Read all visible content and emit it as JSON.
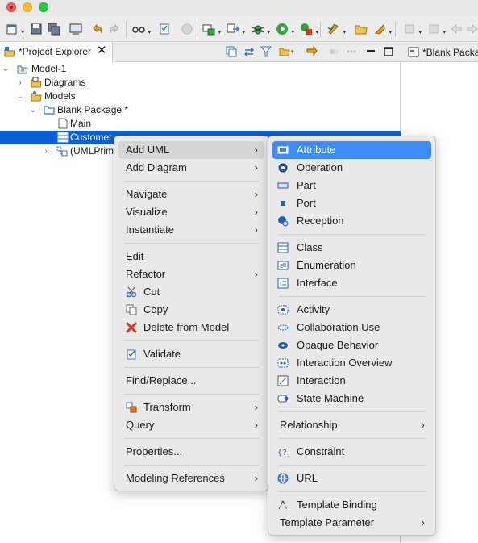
{
  "explorer": {
    "tab_title": "*Project Explorer",
    "close_glyph": "✕",
    "tree": [
      {
        "label": "Model-1",
        "icon": "model-folder-icon"
      },
      {
        "label": "Diagrams",
        "icon": "diagrams-folder-icon"
      },
      {
        "label": "Models",
        "icon": "models-folder-icon"
      },
      {
        "label": "Blank Package *",
        "icon": "package-icon"
      },
      {
        "label": "Main",
        "icon": "diagram-file-icon"
      },
      {
        "label": "Customer",
        "icon": "class-icon",
        "selected": true
      },
      {
        "label": "(UMLPrimi",
        "icon": "library-icon"
      }
    ]
  },
  "editor_tab": {
    "title": "*Blank Packa"
  },
  "context_menu": {
    "items": [
      {
        "label": "Add UML",
        "submenu": true,
        "state": "open"
      },
      {
        "label": "Add Diagram",
        "submenu": true
      },
      {
        "label": "Navigate",
        "submenu": true
      },
      {
        "label": "Visualize",
        "submenu": true
      },
      {
        "label": "Instantiate",
        "submenu": true
      },
      {
        "label": "Edit"
      },
      {
        "label": "Refactor",
        "submenu": true
      },
      {
        "label": "Cut",
        "icon": "scissors-icon"
      },
      {
        "label": "Copy",
        "icon": "copy-icon"
      },
      {
        "label": "Delete from Model",
        "icon": "delete-icon"
      },
      {
        "label": "Validate",
        "icon": "validate-icon"
      },
      {
        "label": "Find/Replace..."
      },
      {
        "label": "Transform",
        "submenu": true,
        "icon": "transform-icon"
      },
      {
        "label": "Query",
        "submenu": true
      },
      {
        "label": "Properties..."
      },
      {
        "label": "Modeling References",
        "submenu": true
      }
    ],
    "submenu_arrow": "›"
  },
  "uml_submenu": {
    "items": [
      {
        "label": "Attribute",
        "icon": "attribute-icon",
        "state": "highlighted"
      },
      {
        "label": "Operation",
        "icon": "operation-icon"
      },
      {
        "label": "Part",
        "icon": "part-icon"
      },
      {
        "label": "Port",
        "icon": "port-icon"
      },
      {
        "label": "Reception",
        "icon": "reception-icon"
      },
      {
        "label": "Class",
        "icon": "class-icon"
      },
      {
        "label": "Enumeration",
        "icon": "enumeration-icon"
      },
      {
        "label": "Interface",
        "icon": "interface-icon"
      },
      {
        "label": "Activity",
        "icon": "activity-icon"
      },
      {
        "label": "Collaboration Use",
        "icon": "collaboration-use-icon"
      },
      {
        "label": "Opaque Behavior",
        "icon": "opaque-behavior-icon"
      },
      {
        "label": "Interaction Overview",
        "icon": "interaction-overview-icon"
      },
      {
        "label": "Interaction",
        "icon": "interaction-icon"
      },
      {
        "label": "State Machine",
        "icon": "state-machine-icon"
      },
      {
        "label": "Relationship",
        "submenu": true
      },
      {
        "label": "Constraint",
        "icon": "constraint-icon"
      },
      {
        "label": "URL",
        "icon": "url-icon"
      },
      {
        "label": "Template Binding",
        "icon": "template-binding-icon"
      },
      {
        "label": "Template Parameter",
        "submenu": true
      }
    ]
  },
  "colors": {
    "selection": "#0a5fd8",
    "menu_highlight": "#3d8cf7",
    "menu_background": "#e9e9e9"
  }
}
